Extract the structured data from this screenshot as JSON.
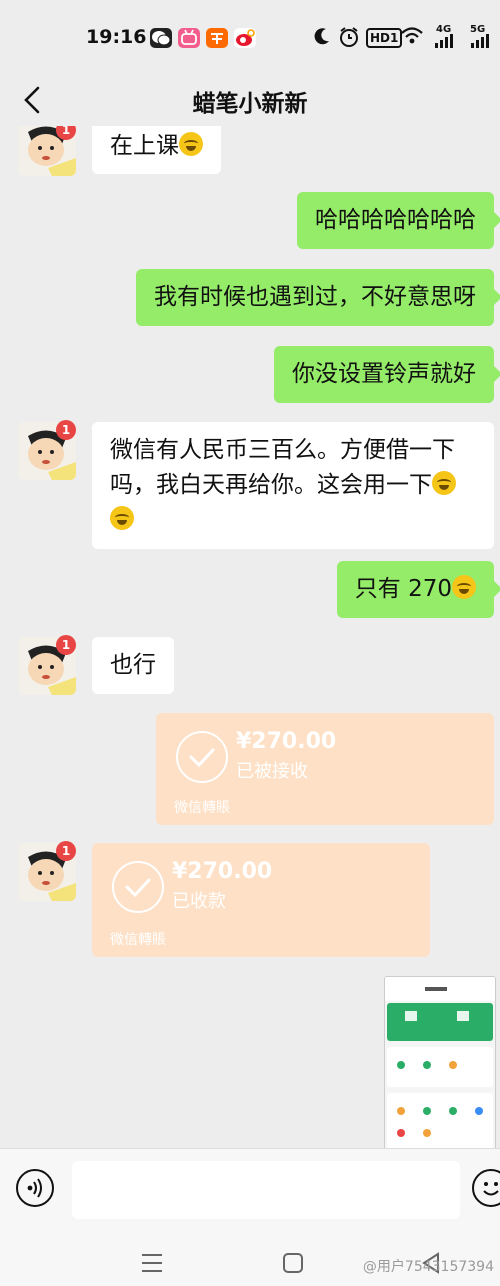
{
  "status_bar": {
    "time": "19:16",
    "hd_label": "HD1",
    "network_4g": "4G",
    "network_5g": "5G",
    "app_icons": [
      "wechat-icon",
      "bilibili-icon",
      "taobao-icon",
      "weibo-icon"
    ],
    "system_icons": [
      "moon-icon",
      "alarm-icon",
      "hd-icon",
      "wifi-icon",
      "signal-icon"
    ]
  },
  "header": {
    "title": "蜡笔小新新"
  },
  "messages": {
    "m1": {
      "side": "left",
      "text": "在上课",
      "badge": "1"
    },
    "m2": {
      "side": "right",
      "text": "哈哈哈哈哈哈哈"
    },
    "m3": {
      "side": "right",
      "text": "我有时候也遇到过，不好意思呀"
    },
    "m4": {
      "side": "right",
      "text": "你没设置铃声就好"
    },
    "m5": {
      "side": "left",
      "line1": "微信有人民币三百么。方便借一下",
      "line2": "吗，我白天再给你。这会用一下",
      "badge": "1"
    },
    "m6": {
      "side": "right",
      "text": "只有 270"
    },
    "m7": {
      "side": "left",
      "text": "也行",
      "badge": "1"
    },
    "m8": {
      "side": "right",
      "type": "transfer",
      "amount": "¥270.00",
      "status": "已被接收",
      "footer": "微信轉賬"
    },
    "m9": {
      "side": "left",
      "type": "transfer",
      "amount": "¥270.00",
      "status": "已收款",
      "footer": "微信轉賬",
      "badge": "1"
    },
    "m10": {
      "side": "right",
      "type": "image"
    }
  },
  "colors": {
    "background": "#ededed",
    "sent_bubble": "#95ec69",
    "received_bubble": "#ffffff",
    "transfer_card": "#fde0c5",
    "badge": "#e84545"
  },
  "navigation": {
    "watermark": "@用户7543157394"
  }
}
